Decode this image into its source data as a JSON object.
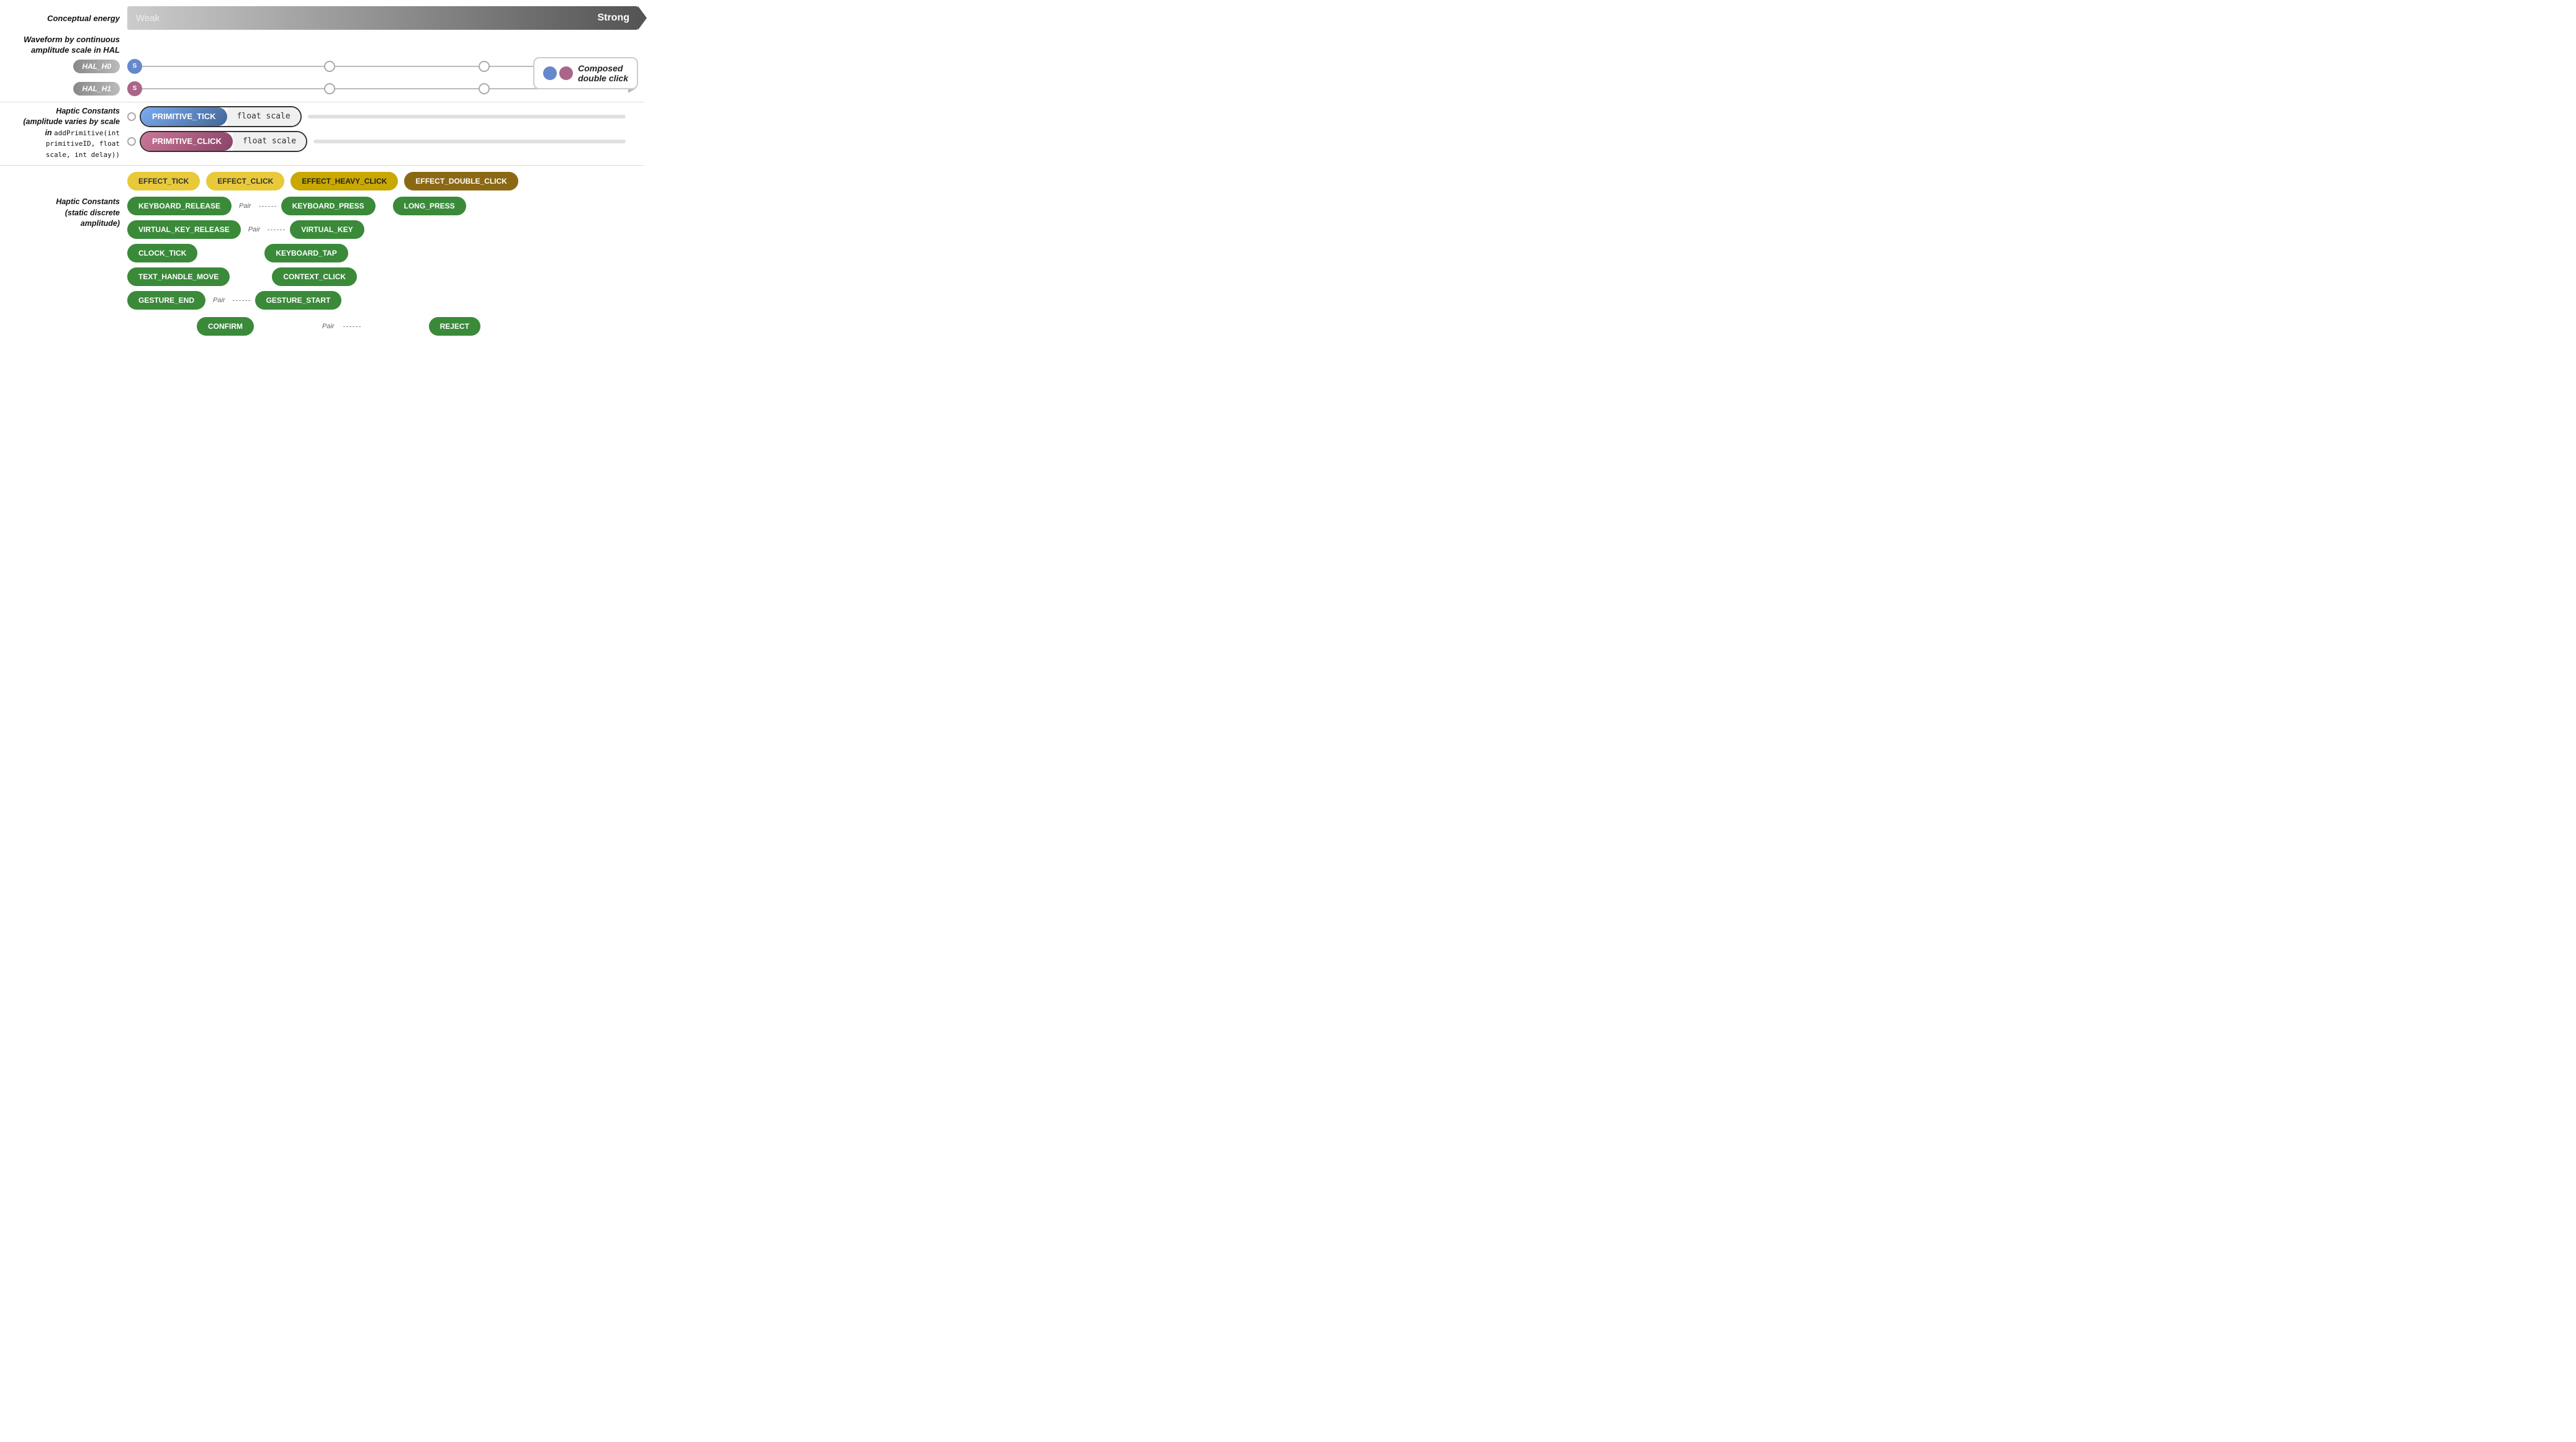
{
  "energy": {
    "label": "Conceptual energy",
    "weak": "Weak",
    "strong": "Strong"
  },
  "waveform": {
    "label": "Waveform by continuous\namplitude scale in HAL"
  },
  "hal": {
    "h0_label": "HAL_H0",
    "h1_label": "HAL_H1",
    "start_s": "S"
  },
  "composed": {
    "text": "Composed\ndouble click"
  },
  "haptic_continuous": {
    "label": "Haptic Constants\n(amplitude varies by scale\nin addPrimitive(int\nprimitiveID, float\nscale, int delay))",
    "primitive_tick": "PRIMITIVE_TICK",
    "primitive_click": "PRIMITIVE_CLICK",
    "float_scale": "float scale"
  },
  "haptic_discrete": {
    "label": "Haptic Constants\n(static discrete\namplitude)",
    "effects": [
      {
        "id": "effect-tick",
        "label": "EFFECT_TICK",
        "style": "yellow-light"
      },
      {
        "id": "effect-click",
        "label": "EFFECT_CLICK",
        "style": "yellow-light"
      },
      {
        "id": "effect-heavy-click",
        "label": "EFFECT_HEAVY_CLICK",
        "style": "yellow-mid"
      },
      {
        "id": "effect-double-click",
        "label": "EFFECT_DOUBLE_CLICK",
        "style": "yellow-dark"
      }
    ],
    "row1_left": "KEYBOARD_RELEASE",
    "row1_pair": "Pair",
    "row1_right": "KEYBOARD_PRESS",
    "row1_extra": "LONG_PRESS",
    "row2_left": "VIRTUAL_KEY_RELEASE",
    "row2_pair": "Pair",
    "row2_right": "VIRTUAL_KEY",
    "row3_left": "CLOCK_TICK",
    "row3_right": "KEYBOARD_TAP",
    "row4_left": "TEXT_HANDLE_MOVE",
    "row4_right": "CONTEXT_CLICK",
    "row5_left": "GESTURE_END",
    "row5_pair": "Pair",
    "row5_right": "GESTURE_START",
    "confirm": "CONFIRM",
    "reject": "REJECT",
    "pair_label": "Pair"
  }
}
